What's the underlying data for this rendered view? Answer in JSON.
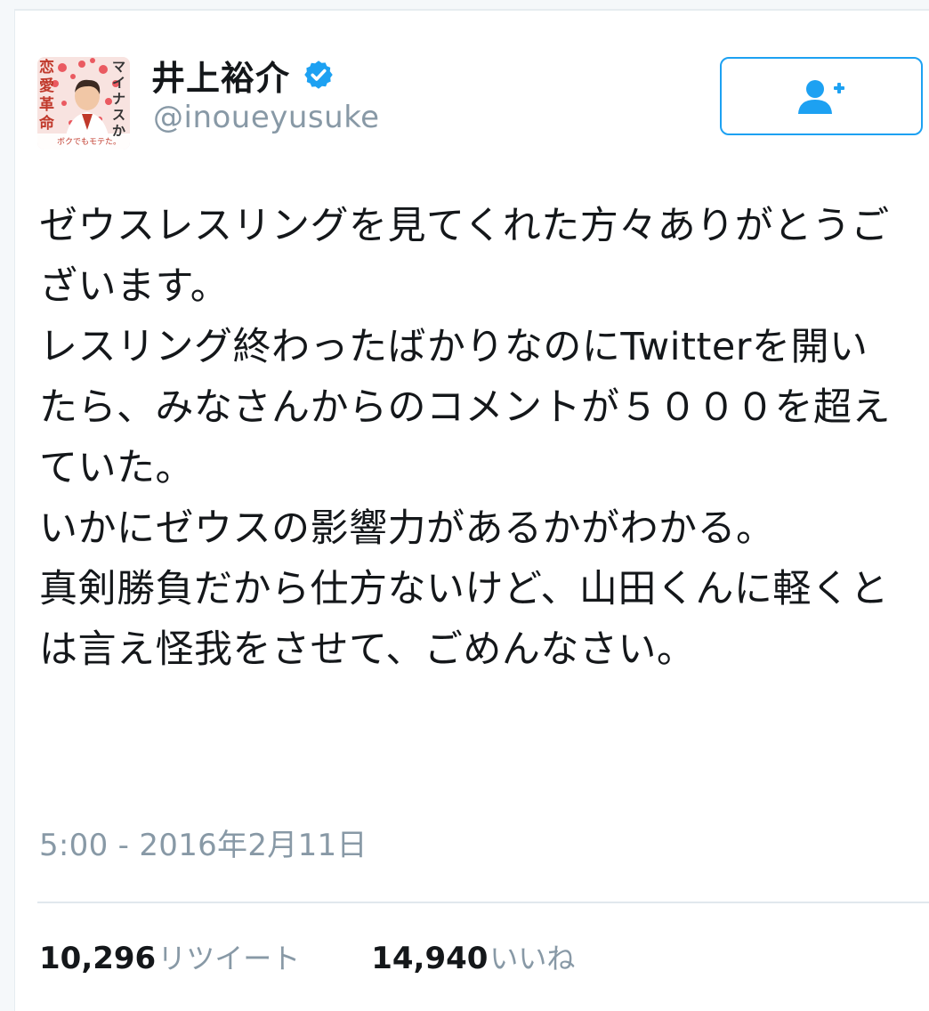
{
  "user": {
    "display_name": "井上裕介",
    "handle": "@inoueyusuke",
    "verified": true,
    "avatar": {
      "vertical_text_left": "恋愛革命",
      "vertical_text_right": "マイナスか",
      "caption": "ボクでもモテた。"
    }
  },
  "follow_button": {
    "icon": "add-user-icon"
  },
  "tweet": {
    "text": "ゼウスレスリングを見てくれた方々ありがとうございます。\nレスリング終わったばかりなのにTwitterを開いたら、みなさんからのコメントが５０００を超えていた。\nいかにゼウスの影響力があるかがわかる。\n真剣勝負だから仕方ないけど、山田くんに軽くとは言え怪我をさせて、ごめんなさい。",
    "timestamp": "5:00 - 2016年2月11日"
  },
  "stats": {
    "retweets_count": "10,296",
    "retweets_label": "リツイート",
    "likes_count": "14,940",
    "likes_label": "いいね"
  },
  "colors": {
    "accent": "#1da1f2",
    "secondary_text": "#8899a6",
    "divider": "#e1e8ed"
  }
}
